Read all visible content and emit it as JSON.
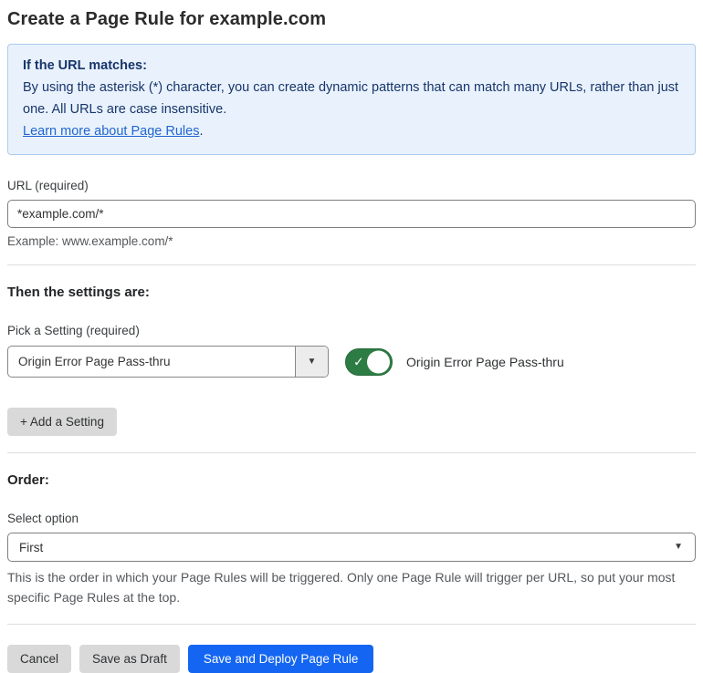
{
  "page": {
    "title": "Create a Page Rule for example.com"
  },
  "info_box": {
    "heading": "If the URL matches:",
    "body": "By using the asterisk (*) character, you can create dynamic patterns that can match many URLs, rather than just one. All URLs are case insensitive.",
    "link_label": "Learn more about Page Rules",
    "link_suffix": "."
  },
  "url_field": {
    "label": "URL (required)",
    "value": "*example.com/*",
    "helper": "Example: www.example.com/*"
  },
  "settings_section": {
    "heading": "Then the settings are:",
    "picker_label": "Pick a Setting (required)",
    "picker_value": "Origin Error Page Pass-thru",
    "toggle_state": "on",
    "toggle_check": "✓",
    "toggle_label": "Origin Error Page Pass-thru",
    "add_setting_label": "+ Add a Setting"
  },
  "order_section": {
    "heading": "Order:",
    "select_label": "Select option",
    "select_value": "First",
    "helper": "This is the order in which your Page Rules will be triggered. Only one Page Rule will trigger per URL, so put your most specific Page Rules at the top."
  },
  "footer": {
    "cancel_label": "Cancel",
    "save_draft_label": "Save as Draft",
    "save_deploy_label": "Save and Deploy Page Rule"
  },
  "icons": {
    "caret_down": "▼"
  },
  "colors": {
    "info_bg": "#e9f2fc",
    "info_border": "#abcbec",
    "info_text": "#17356b",
    "link_blue": "#2166cf",
    "toggle_green": "#2d7c44",
    "primary_blue": "#1466f2",
    "button_gray": "#d9d9d9"
  }
}
